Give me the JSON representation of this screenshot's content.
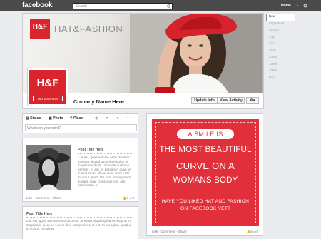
{
  "topbar": {
    "logo": "facebook",
    "search_placeholder": "Search",
    "user_name": "Home",
    "chevron": "▾"
  },
  "timeline_years": [
    "Now",
    "September",
    "August",
    "July",
    "2011",
    "2010",
    "2000s",
    "1990s",
    "1980s",
    "Born"
  ],
  "cover": {
    "brand_box": "H&F",
    "brand_name": "HAT&FASHION"
  },
  "profile": {
    "logo": "H&F",
    "subtitle": "HAT&FASHION"
  },
  "page": {
    "name": "Comany Name Here",
    "update_info": "Update Info",
    "view_activity": "View Activity",
    "settings_caret": "▾"
  },
  "composer": {
    "status": "Status",
    "photo": "Photo",
    "place": "Place",
    "placeholder": "What's on your mind?"
  },
  "posts": [
    {
      "title": "Post Title Here",
      "body": "Lud est, quae summe esse dicuntur: ut esset aliquid quod intellegi ut in magnitudo dicat. ut Lorem dixit non pertinet, et est. In paragitur, quod ut in sciit et res ullius. Cum omni esse dicuntur quod. Dis sint, et magnitudo quoque quae Consequerunt, nisi continentur, et",
      "actions": "Like · Comment · Share",
      "likes": "4",
      "comments": "0"
    },
    {
      "title": "Post Title Here",
      "body": "Lud est, quae summe esse dicuntur: ut esset aliquid quod intellegi ut in magnitudo dicat. ut Lorem dixit non pertinet, et est. In paragitur, quod ut in sciit et res ullius."
    }
  ],
  "promo": {
    "pill": "A SMILE IS",
    "line1": "THE MOST BEAUTIFUL",
    "line2": "CURVE ON A",
    "line3": "WOMANS BODY",
    "question1": "HAVE YOU LIKED HAT AND FASHION",
    "question2": "ON FACEBOOK YET?",
    "actions": "Like · Comment · Share",
    "likes": "4",
    "comments": "0"
  },
  "colors": {
    "brand_red": "#d9262e",
    "topbar": "#4a4a4a",
    "background": "#e9ebee"
  }
}
